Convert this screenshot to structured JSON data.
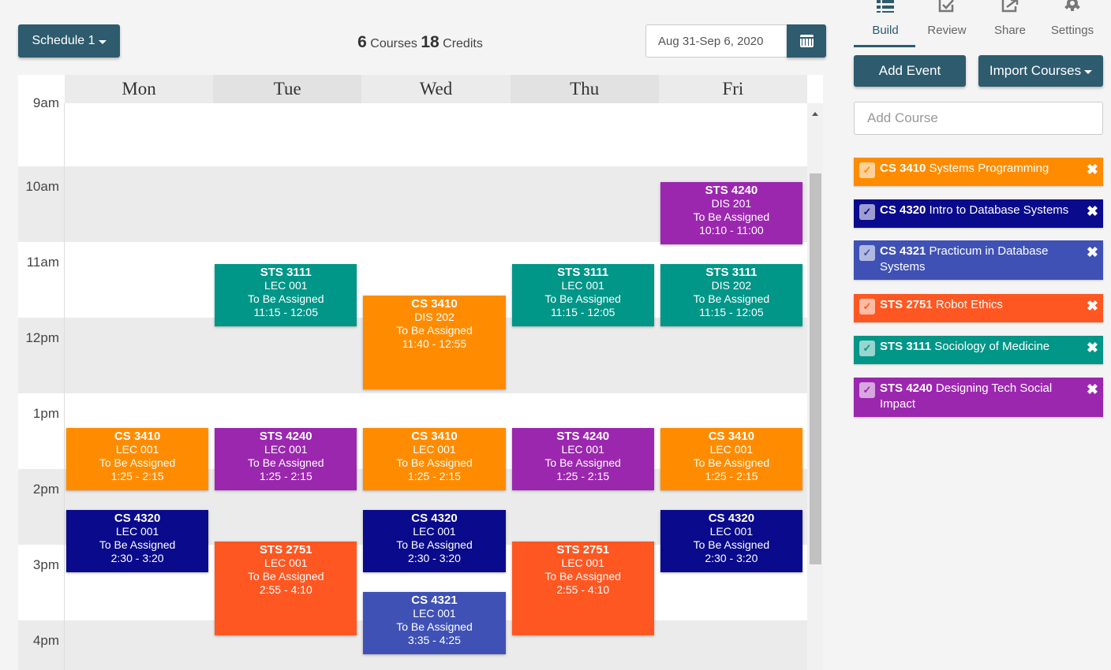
{
  "toolbar": {
    "schedule_label": "Schedule 1",
    "courses_count": "6",
    "courses_label": "Courses",
    "credits_count": "18",
    "credits_label": "Credits",
    "date_range": "Aug 31-Sep 6, 2020",
    "calendar_icon": "calendar-icon"
  },
  "calendar": {
    "days": [
      "Mon",
      "Tue",
      "Wed",
      "Thu",
      "Fri"
    ],
    "hours": [
      "9am",
      "10am",
      "11am",
      "12pm",
      "1pm",
      "2pm",
      "3pm",
      "4pm"
    ],
    "events": [
      {
        "day": 4,
        "code": "STS 4240",
        "section": "DIS 201",
        "room": "To Be Assigned",
        "time": "10:10 - 11:00",
        "color": "#9b27af"
      },
      {
        "day": 1,
        "code": "STS 3111",
        "section": "LEC 001",
        "room": "To Be Assigned",
        "time": "11:15 - 12:05",
        "color": "#009688"
      },
      {
        "day": 3,
        "code": "STS 3111",
        "section": "LEC 001",
        "room": "To Be Assigned",
        "time": "11:15 - 12:05",
        "color": "#009688"
      },
      {
        "day": 4,
        "code": "STS 3111",
        "section": "DIS 202",
        "room": "To Be Assigned",
        "time": "11:15 - 12:05",
        "color": "#009688"
      },
      {
        "day": 2,
        "code": "CS 3410",
        "section": "DIS 202",
        "room": "To Be Assigned",
        "time": "11:40 - 12:55",
        "color": "#ff8c00"
      },
      {
        "day": 0,
        "code": "CS 3410",
        "section": "LEC 001",
        "room": "To Be Assigned",
        "time": "1:25 - 2:15",
        "color": "#ff8c00"
      },
      {
        "day": 1,
        "code": "STS 4240",
        "section": "LEC 001",
        "room": "To Be Assigned",
        "time": "1:25 - 2:15",
        "color": "#9b27af"
      },
      {
        "day": 2,
        "code": "CS 3410",
        "section": "LEC 001",
        "room": "To Be Assigned",
        "time": "1:25 - 2:15",
        "color": "#ff8c00"
      },
      {
        "day": 3,
        "code": "STS 4240",
        "section": "LEC 001",
        "room": "To Be Assigned",
        "time": "1:25 - 2:15",
        "color": "#9b27af"
      },
      {
        "day": 4,
        "code": "CS 3410",
        "section": "LEC 001",
        "room": "To Be Assigned",
        "time": "1:25 - 2:15",
        "color": "#ff8c00"
      },
      {
        "day": 0,
        "code": "CS 4320",
        "section": "LEC 001",
        "room": "To Be Assigned",
        "time": "2:30 - 3:20",
        "color": "#0a0a8c"
      },
      {
        "day": 2,
        "code": "CS 4320",
        "section": "LEC 001",
        "room": "To Be Assigned",
        "time": "2:30 - 3:20",
        "color": "#0a0a8c"
      },
      {
        "day": 4,
        "code": "CS 4320",
        "section": "LEC 001",
        "room": "To Be Assigned",
        "time": "2:30 - 3:20",
        "color": "#0a0a8c"
      },
      {
        "day": 1,
        "code": "STS 2751",
        "section": "LEC 001",
        "room": "To Be Assigned",
        "time": "2:55 - 4:10",
        "color": "#ff5722"
      },
      {
        "day": 3,
        "code": "STS 2751",
        "section": "LEC 001",
        "room": "To Be Assigned",
        "time": "2:55 - 4:10",
        "color": "#ff5722"
      },
      {
        "day": 2,
        "code": "CS 4321",
        "section": "LEC 001",
        "room": "To Be Assigned",
        "time": "3:35 - 4:25",
        "color": "#3f51b5"
      }
    ]
  },
  "sidebar": {
    "tabs": [
      {
        "label": "Build",
        "icon": "list-icon"
      },
      {
        "label": "Review",
        "icon": "edit-check-icon"
      },
      {
        "label": "Share",
        "icon": "share-icon"
      },
      {
        "label": "Settings",
        "icon": "gear-icon"
      }
    ],
    "add_event_label": "Add Event",
    "import_courses_label": "Import Courses",
    "add_course_placeholder": "Add Course",
    "courses": [
      {
        "code": "CS 3410",
        "title": "Systems Programming",
        "color": "#ff8c00"
      },
      {
        "code": "CS 4320",
        "title": "Intro to Database Systems",
        "color": "#0a0a8c"
      },
      {
        "code": "CS 4321",
        "title": "Practicum in Database Systems",
        "color": "#3f51b5"
      },
      {
        "code": "STS 2751",
        "title": "Robot Ethics",
        "color": "#ff5722"
      },
      {
        "code": "STS 3111",
        "title": "Sociology of Medicine",
        "color": "#009688"
      },
      {
        "code": "STS 4240",
        "title": "Designing Tech Social Impact",
        "color": "#9b27af"
      }
    ]
  }
}
